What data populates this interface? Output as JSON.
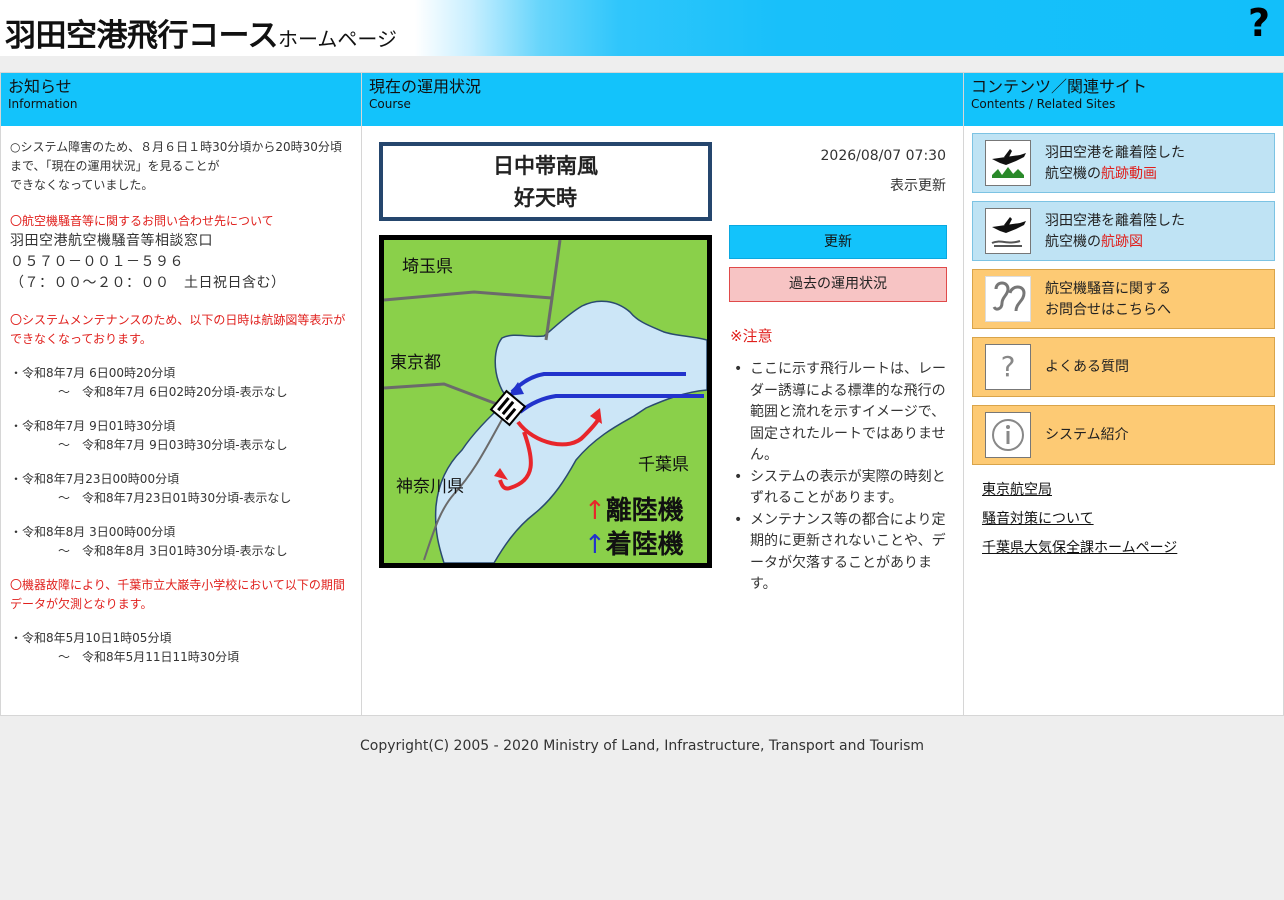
{
  "header": {
    "title": "羽田空港飛行コース",
    "subtitle": "ホームページ",
    "help_icon": "?"
  },
  "info_column": {
    "title_jp": "お知らせ",
    "title_en": "Information",
    "lines": {
      "outage1": "○システム障害のため、８月６日１時30分頃から20時30分頃",
      "outage2": "まで、「現在の運用状況」を見ることが",
      "outage3": "できなくなっていました。",
      "inquiry_head": "〇航空機騒音等に関するお問い合わせ先について",
      "inquiry_office": "羽田空港航空機騒音等相談窓口",
      "inquiry_tel": "０５７０－００１－５９６",
      "inquiry_hours": "（７：００～２０：００　土日祝日含む）",
      "maint1": "〇システムメンテナンスのため、以下の日時は航跡図等表示が",
      "maint2": "できなくなっております。",
      "s1a": "・令和8年7月 6日00時20分頃",
      "s1b": "～　令和8年7月 6日02時20分頃-表示なし",
      "s2a": "・令和8年7月 9日01時30分頃",
      "s2b": "～　令和8年7月 9日03時30分頃-表示なし",
      "s3a": "・令和8年7月23日00時00分頃",
      "s3b": "～　令和8年7月23日01時30分頃-表示なし",
      "s4a": "・令和8年8月 3日00時00分頃",
      "s4b": "～　令和8年8月 3日01時30分頃-表示なし",
      "fault1": "〇機器故障により、千葉市立大巌寺小学校において以下の期間",
      "fault2": "データが欠測となります。",
      "f1a": "・令和8年5月10日1時05分頃",
      "f1b": "～　令和8年5月11日11時30分頃"
    }
  },
  "course_column": {
    "title_jp": "現在の運用状況",
    "title_en": "Course",
    "status_line1": "日中帯南風",
    "status_line2": "好天時",
    "datetime": "2026/08/07 07:30",
    "refresh_label": "表示更新",
    "update_button": "更新",
    "past_button": "過去の運用状況",
    "notice_title": "※注意",
    "notices": [
      "ここに示す飛行ルートは、レーダー誘導による標準的な飛行の範囲と流れを示すイメージで、固定されたルートではありません。",
      "システムの表示が実際の時刻とずれることがあります。",
      "メンテナンス等の都合により定期的に更新されないことや、データが欠落することがあります。"
    ],
    "map": {
      "label_saitama": "埼玉県",
      "label_tokyo": "東京都",
      "label_kanagawa": "神奈川県",
      "label_chiba": "千葉県",
      "legend_arrow": "↑",
      "legend_departure": "離陸機",
      "legend_arrival": "着陸機",
      "departure_color": "#e8262b",
      "arrival_color": "#2233cc",
      "land_color": "#8ad04a",
      "sea_color": "#cce6f7"
    }
  },
  "related_column": {
    "title_jp": "コンテンツ／関連サイト",
    "title_en": "Contents / Related Sites",
    "buttons": {
      "movie_line1": "羽田空港を離着陸した",
      "movie_line2_pre": "航空機の",
      "movie_line2_hl": "航跡動画",
      "map_line1": "羽田空港を離着陸した",
      "map_line2_pre": "航空機の",
      "map_line2_hl": "航跡図",
      "noise_line1": "航空機騒音に関する",
      "noise_line2": "お問合せはこちらへ",
      "faq": "よくある質問",
      "about": "システム紹介"
    },
    "links": {
      "tokyo_aviation": "東京航空局",
      "noise_measures": "騒音対策について",
      "chiba_air": "千葉県大気保全課ホームページ"
    }
  },
  "footer": {
    "copyright": "Copyright(C) 2005 - 2020 Ministry of Land, Infrastructure, Transport and Tourism"
  }
}
